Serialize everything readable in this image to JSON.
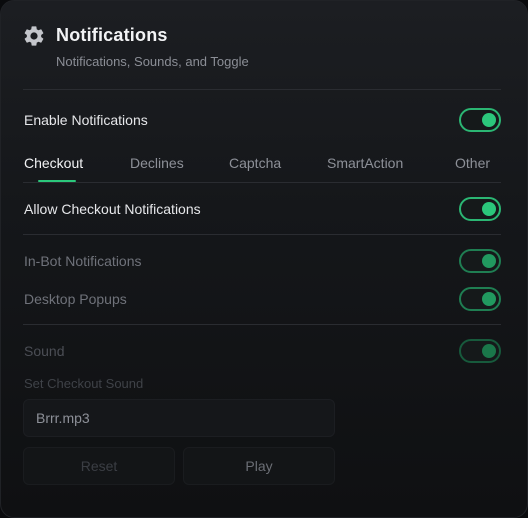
{
  "header": {
    "icon": "gear-icon",
    "title": "Notifications",
    "subtitle": "Notifications, Sounds, and Toggle"
  },
  "enable": {
    "label": "Enable Notifications",
    "on": true
  },
  "tabs": [
    {
      "label": "Checkout",
      "active": true
    },
    {
      "label": "Declines",
      "active": false
    },
    {
      "label": "Captcha",
      "active": false
    },
    {
      "label": "SmartAction",
      "active": false
    },
    {
      "label": "Other",
      "active": false
    }
  ],
  "settings": {
    "allow_checkout": {
      "label": "Allow Checkout Notifications",
      "on": true
    },
    "in_bot": {
      "label": "In-Bot Notifications",
      "on": true
    },
    "desktop_popups": {
      "label": "Desktop Popups",
      "on": true
    },
    "sound": {
      "label": "Sound",
      "on": true
    }
  },
  "sound_picker": {
    "label": "Set Checkout Sound",
    "value": "Brrr.mp3",
    "reset_label": "Reset",
    "play_label": "Play"
  },
  "colors": {
    "accent": "#2bc77b",
    "background": "#15171a"
  }
}
